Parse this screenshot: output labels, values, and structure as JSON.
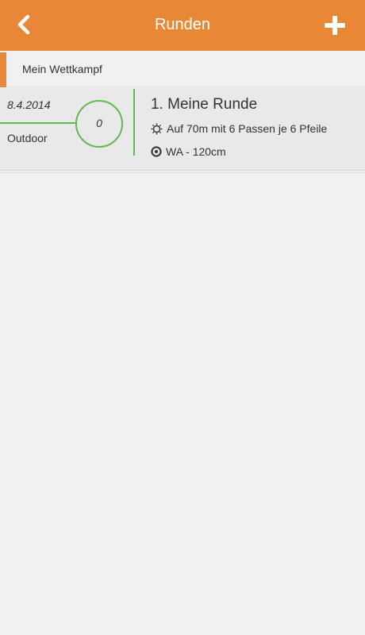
{
  "nav": {
    "title": "Runden",
    "back_icon": "chevron-left-icon",
    "add_icon": "plus-icon",
    "background_color": "#e88837"
  },
  "section": {
    "title": "Mein Wettkampf",
    "accent_color": "#e88837"
  },
  "rounds": [
    {
      "date": "8.4.2014",
      "location": "Outdoor",
      "score": "0",
      "title": "1. Meine Runde",
      "distance_icon": "sun-icon",
      "distance_text": "Auf 70m mit 6 Passen je 6 Pfeile",
      "target_icon": "target-icon",
      "target_text": "WA - 120cm",
      "accent_color": "#63b950"
    }
  ]
}
